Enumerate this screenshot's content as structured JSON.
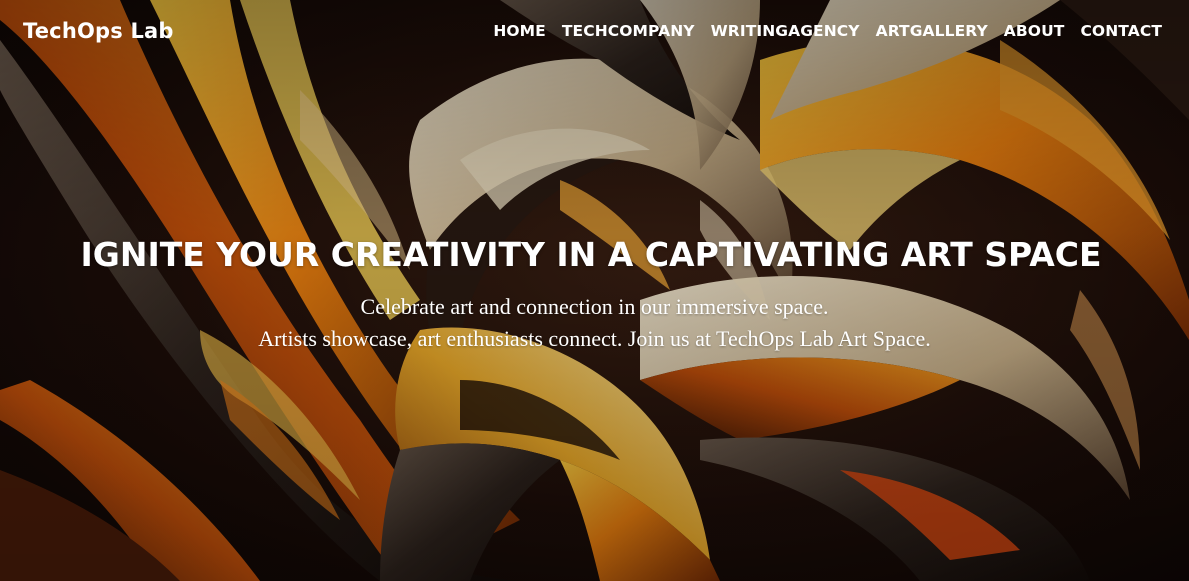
{
  "site": {
    "brand": "TechOps Lab"
  },
  "nav": {
    "items": [
      {
        "label": "HOME"
      },
      {
        "label": "TECHCOMPANY"
      },
      {
        "label": "WRITINGAGENCY"
      },
      {
        "label": "ARTGALLERY"
      },
      {
        "label": "ABOUT"
      },
      {
        "label": "CONTACT"
      }
    ]
  },
  "hero": {
    "title": "IGNITE YOUR CREATIVITY IN A CAPTIVATING ART SPACE",
    "subtitle_line1": "Celebrate art and connection in our immersive space.",
    "subtitle_line2": "Artists showcase, art enthusiasts connect. Join us at TechOps Lab Art Space."
  },
  "colors": {
    "background": "#120806",
    "text": "#ffffff",
    "accent_orange": "#e8750f",
    "accent_gold": "#f3b62c",
    "accent_cream": "#e9d8b9"
  }
}
